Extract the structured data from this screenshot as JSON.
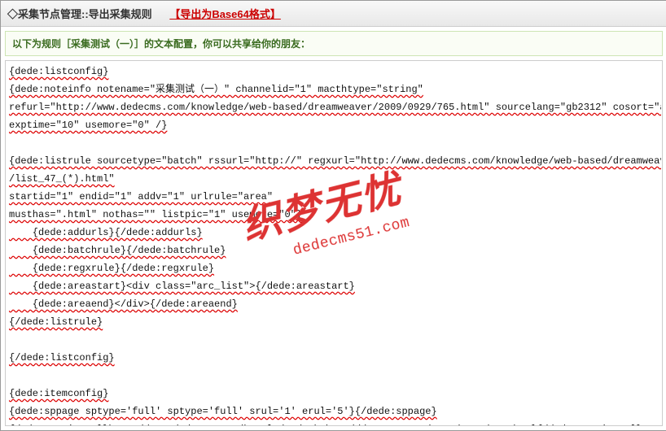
{
  "header": {
    "diamond": "◇",
    "title": "采集节点管理::导出采集规则",
    "export_link": "【导出为Base64格式】"
  },
  "subtitle": "以下为规则［采集测试（一）］的文本配置，你可以共享给你的朋友：",
  "watermark": {
    "cn": "织梦无忧",
    "en": "dedecms51.com"
  },
  "config": "{dede:listconfig}\n{dede:noteinfo notename=\"采集测试（一）\" channelid=\"1\" macthtype=\"string\"\nrefurl=\"http://www.dedecms.com/knowledge/web-based/dreamweaver/2009/0929/765.html\" sourcelang=\"gb2312\" cosort=\"asc\" isref=\"no\"\nexptime=\"10\" usemore=\"0\" /}\n\n{dede:listrule sourcetype=\"batch\" rssurl=\"http://\" regxurl=\"http://www.dedecms.com/knowledge/web-based/dreamweaver\n/list_47_(*).html\"\nstartid=\"1\" endid=\"1\" addv=\"1\" urlrule=\"area\"\nmusthas=\".html\" nothas=\"\" listpic=\"1\" usemore=\"0\"}\n    {dede:addurls}{/dede:addurls}\n    {dede:batchrule}{/dede:batchrule}\n    {dede:regxrule}{/dede:regxrule}\n    {dede:areastart}<div class=\"arc_list\">{/dede:areastart}\n    {dede:areaend}</div>{/dede:areaend}\n{/dede:listrule}\n\n{/dede:listconfig}\n\n{dede:itemconfig}\n{dede:sppage sptype='full' sptype='full' srul='1' erul='5'}{/dede:sppage}\n{dede:previewurl}http://www.dedecms.com/knowledge/web-based/dreamweaver/2009/0929/765.html{/dede:previewurl}\n{dede:keywordtrim}{/dede:keywordtrim}\n{dede:descriptiontrim}{/dede:descriptiontrim}\n{dede:item field='title' value='' isunit='' isdown=''}\n{dede:match}<div class=\"arcbody\"><h1>[内容]</h1>{/dede:match}"
}
